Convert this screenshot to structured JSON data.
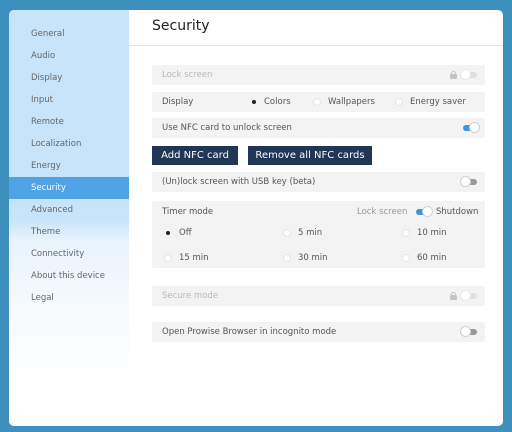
{
  "sidebar": {
    "items": [
      {
        "label": "General",
        "active": false
      },
      {
        "label": "Audio",
        "active": false
      },
      {
        "label": "Display",
        "active": false
      },
      {
        "label": "Input",
        "active": false
      },
      {
        "label": "Remote",
        "active": false
      },
      {
        "label": "Localization",
        "active": false
      },
      {
        "label": "Energy",
        "active": false
      },
      {
        "label": "Security",
        "active": true
      },
      {
        "label": "Advanced",
        "active": false
      },
      {
        "label": "Theme",
        "active": false
      },
      {
        "label": "Connectivity",
        "active": false
      },
      {
        "label": "About this device",
        "active": false
      },
      {
        "label": "Legal",
        "active": false
      }
    ]
  },
  "page": {
    "title": "Security"
  },
  "settings": {
    "lock_screen": {
      "label": "Lock screen",
      "enabled": false,
      "state": "off"
    },
    "display": {
      "label": "Display",
      "options": [
        "Colors",
        "Wallpapers",
        "Energy saver"
      ],
      "selected": "Colors"
    },
    "nfc": {
      "label": "Use NFC card to unlock screen",
      "state": "on"
    },
    "buttons": {
      "add_nfc": "Add NFC card",
      "remove_nfc": "Remove all NFC cards"
    },
    "usb": {
      "label": "(Un)lock screen with USB key (beta)",
      "state": "off"
    },
    "timer": {
      "label": "Timer mode",
      "toggle_left": "Lock screen",
      "toggle_right": "Shutdown",
      "toggle_state": "on",
      "options": [
        "Off",
        "5 min",
        "10 min",
        "15 min",
        "30 min",
        "60 min"
      ],
      "selected": "Off"
    },
    "secure_mode": {
      "label": "Secure mode",
      "enabled": false,
      "state": "off"
    },
    "incognito": {
      "label": "Open Prowise Browser in incognito mode",
      "state": "off"
    }
  },
  "colors": {
    "background": "#3d8fbe",
    "sidebar_active": "#4fa3e6",
    "sidebar": "#c7e4fa",
    "button": "#1f3654",
    "toggle_on": "#3a95e0"
  }
}
